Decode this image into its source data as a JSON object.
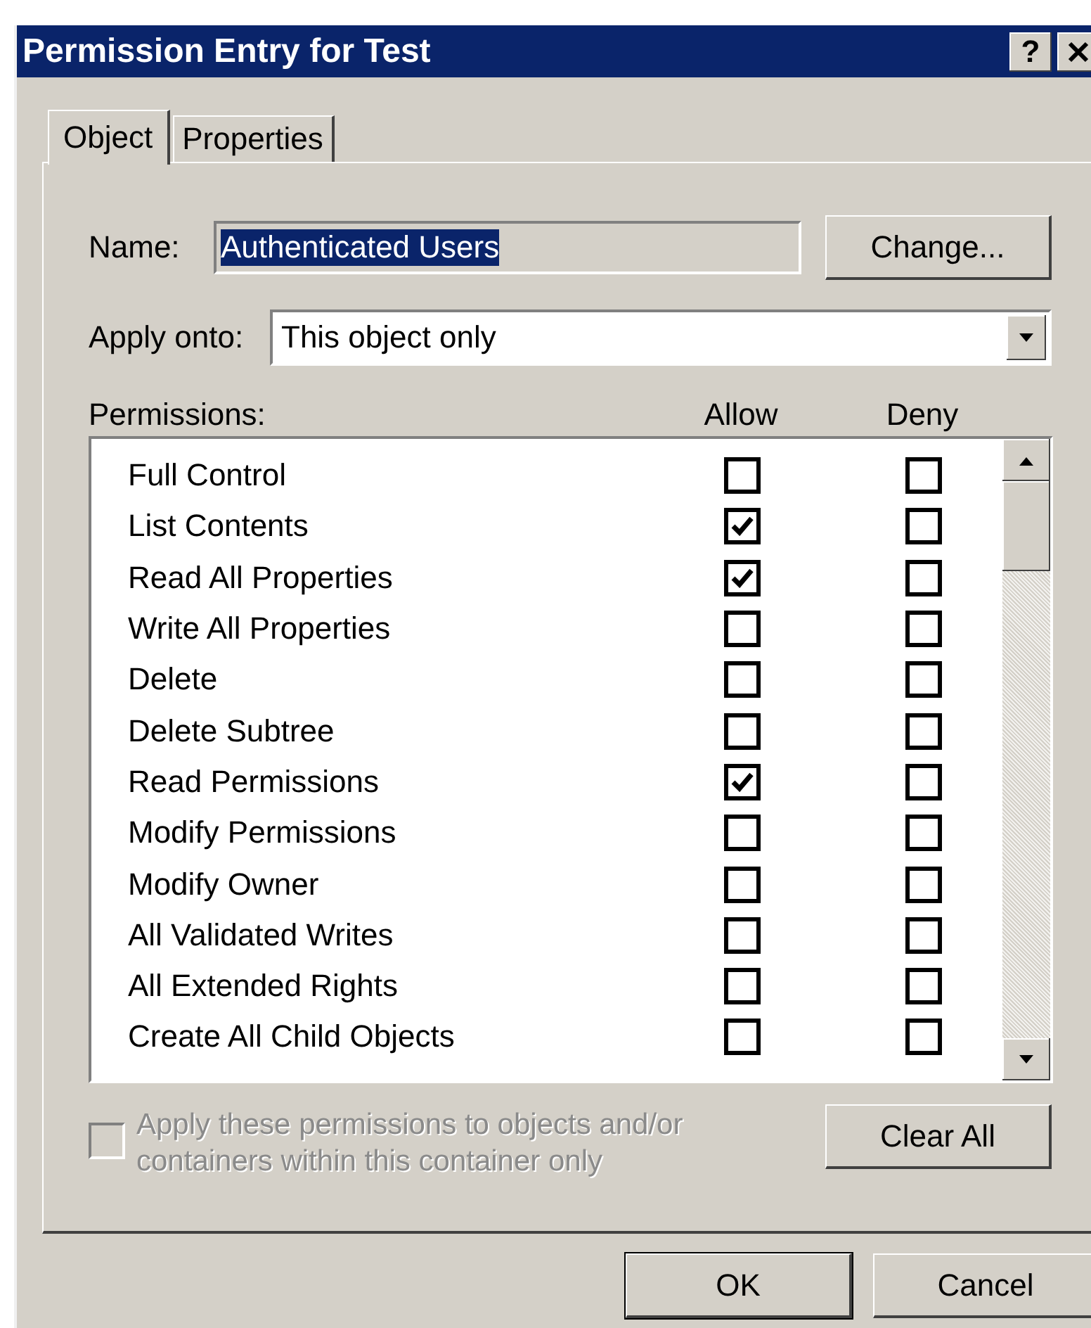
{
  "window": {
    "title": "Permission Entry for Test",
    "help_button": "?"
  },
  "tabs": [
    {
      "label": "Object",
      "selected": true
    },
    {
      "label": "Properties",
      "selected": false
    }
  ],
  "name_field": {
    "label": "Name:",
    "value": "Authenticated Users",
    "value_selected": true
  },
  "change_button": {
    "label": "Change..."
  },
  "apply_onto": {
    "label": "Apply onto:",
    "value": "This object only"
  },
  "permissions": {
    "label": "Permissions:",
    "columns": [
      "Allow",
      "Deny"
    ],
    "rows": [
      {
        "name": "Full Control",
        "allow": false,
        "deny": false
      },
      {
        "name": "List Contents",
        "allow": true,
        "deny": false
      },
      {
        "name": "Read All Properties",
        "allow": true,
        "deny": false
      },
      {
        "name": "Write All Properties",
        "allow": false,
        "deny": false
      },
      {
        "name": "Delete",
        "allow": false,
        "deny": false
      },
      {
        "name": "Delete Subtree",
        "allow": false,
        "deny": false
      },
      {
        "name": "Read Permissions",
        "allow": true,
        "deny": false
      },
      {
        "name": "Modify Permissions",
        "allow": false,
        "deny": false
      },
      {
        "name": "Modify Owner",
        "allow": false,
        "deny": false
      },
      {
        "name": "All Validated Writes",
        "allow": false,
        "deny": false
      },
      {
        "name": "All Extended Rights",
        "allow": false,
        "deny": false
      },
      {
        "name": "Create All Child Objects",
        "allow": false,
        "deny": false
      }
    ]
  },
  "apply_within": {
    "label": "Apply these permissions to objects and/or containers within this container only",
    "checked": false,
    "disabled": true
  },
  "clear_all_button": {
    "label": "Clear All"
  },
  "footer_buttons": [
    {
      "label": "OK",
      "default": true
    },
    {
      "label": "Cancel",
      "default": false
    }
  ]
}
